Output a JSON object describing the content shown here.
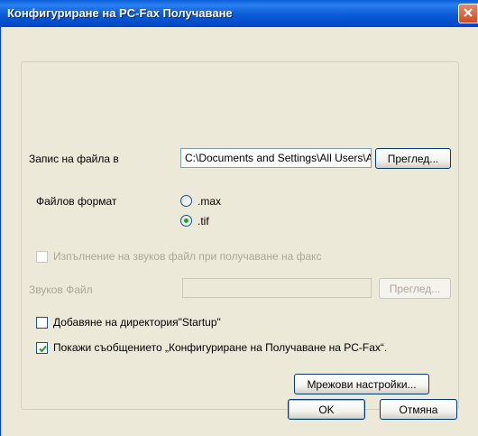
{
  "window": {
    "title": "Конфигуриране на PC-Fax Получаване",
    "close_icon": "close-icon",
    "accent": "#0a5ed8"
  },
  "save_to": {
    "label": "Запис на файла в",
    "value": "C:\\Documents and Settings\\All Users\\Application Data\\Brother",
    "browse_label": "Преглед..."
  },
  "file_format": {
    "label": "Файлов формат",
    "options": [
      {
        "label": ".max",
        "selected": false
      },
      {
        "label": ".tif",
        "selected": true
      }
    ]
  },
  "sound": {
    "checkbox_label": "Изпълнение на звуков файл при получаване на факс",
    "checked": false,
    "file_label": "Звуков Файл",
    "file_value": "",
    "browse_label": "Преглед..."
  },
  "startup": {
    "label": "Добавяне на директория\"Startup\"",
    "checked": false
  },
  "show_message": {
    "label": "Покажи съобщението „Конфигуриране на Получаване на PC-Fax“.",
    "checked": true
  },
  "network_button": "Мрежови настройки...",
  "ok_button": "OK",
  "cancel_button": "Отмяна",
  "colors": {
    "check_mark": "#21a121",
    "disabled_text": "#aca899"
  }
}
